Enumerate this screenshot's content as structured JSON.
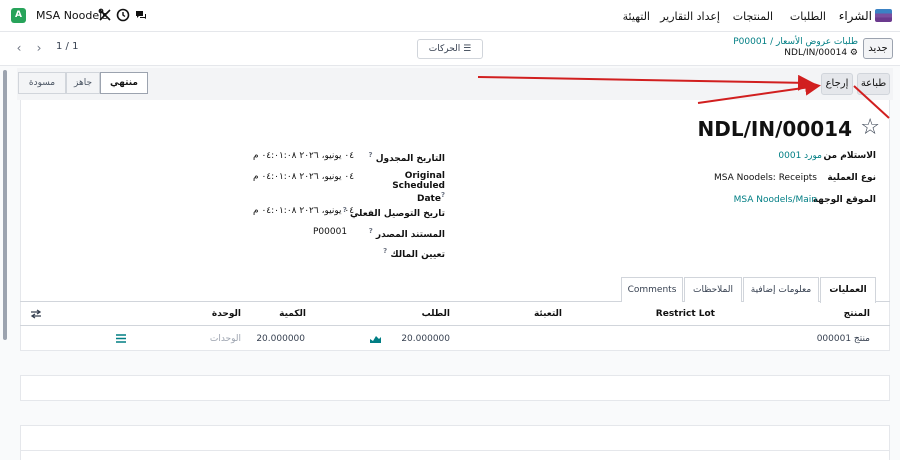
{
  "topnav": {
    "brand": "الشراء",
    "menu": [
      "الطلبات",
      "المنتجات",
      "إعداد التقارير",
      "التهيئة"
    ],
    "company": "MSA Noodels",
    "avatar_letter": "A",
    "icons": [
      "tools-icon",
      "clock-icon",
      "chat-icon"
    ]
  },
  "control_panel": {
    "new_label": "جديد",
    "breadcrumb_parent": "P00001 / طلبات عروض الأسعار",
    "breadcrumb_current": "NDL/IN/00014",
    "actions_label": "الحركات",
    "pager": "1 / 1"
  },
  "buttons": {
    "print": "طباعة",
    "return": "إرجاع"
  },
  "status": {
    "states": [
      "مسودة",
      "جاهز",
      "منتهي"
    ],
    "active": "منتهي"
  },
  "record": {
    "title": "NDL/IN/00014",
    "fields_right": [
      {
        "label": "الاستلام من",
        "value": "مورد 0001",
        "link": true
      },
      {
        "label": "نوع العملية",
        "value": "MSA Noodels: Receipts",
        "link": false
      },
      {
        "label": "الموقع الوجهة",
        "value": "MSA Noodels/Main",
        "link": true
      }
    ],
    "fields_left": [
      {
        "label": "التاريخ المجدول",
        "value": "٠٤ يونيو، ٢٠٢٦ ٠٤:٠١:٠٨ م"
      },
      {
        "label": "Original Scheduled Date",
        "value": "٠٤ يونيو، ٢٠٢٦ ٠٤:٠١:٠٨ م"
      },
      {
        "label": "تاريخ التوصيل الفعلي",
        "value": "٠٤ يونيو، ٢٠٢٦ ٠٤:٠١:٠٨ م"
      },
      {
        "label": "المستند المصدر",
        "value": "P00001"
      },
      {
        "label": "تعيين المالك",
        "value": ""
      }
    ]
  },
  "tabs": [
    "العمليات",
    "معلومات إضافية",
    "الملاحظات",
    "Comments"
  ],
  "table": {
    "headers": {
      "product": "المنتج",
      "restrict_lot": "Restrict Lot",
      "packaging": "التعبئة",
      "demand": "الطلب",
      "quantity": "الكمية",
      "unit": "الوحدة"
    },
    "rows": [
      {
        "product": "منتج 000001",
        "restrict_lot": "",
        "packaging": "",
        "demand": "20.000000",
        "quantity": "20.000000",
        "unit": "الوحدات"
      }
    ]
  },
  "colors": {
    "accent": "#017e84",
    "arrow": "#d11f1f"
  }
}
